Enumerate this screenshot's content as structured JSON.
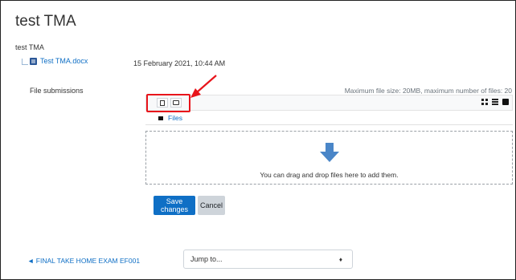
{
  "page": {
    "title": "test TMA",
    "subtitle": "test TMA"
  },
  "attachment": {
    "file_name": "Test TMA.docx",
    "timestamp": "15 February 2021, 10:44 AM"
  },
  "submissions": {
    "label": "File submissions",
    "limits": "Maximum file size: 20MB, maximum number of files: 20",
    "path_root": "Files",
    "drop_text": "You can drag and drop files here to add them."
  },
  "actions": {
    "save_label": "Save changes",
    "cancel_label": "Cancel"
  },
  "navigation": {
    "prev_link": "◄ FINAL TAKE HOME EXAM EF001",
    "jump_to": "Jump to...",
    "jump_caret": "♦"
  },
  "annotation": {
    "color": "#e8141b"
  },
  "icons": {
    "toolbar": [
      "add-file-icon",
      "create-folder-icon"
    ],
    "views": [
      "icons-view-icon",
      "list-view-icon",
      "tree-view-icon"
    ],
    "drop": "upload-arrow-icon"
  },
  "colors": {
    "link": "#0f6fc5",
    "primary_button": "#0f6fc5",
    "secondary_button": "#ced4da",
    "upload_arrow": "#4a86c8"
  }
}
